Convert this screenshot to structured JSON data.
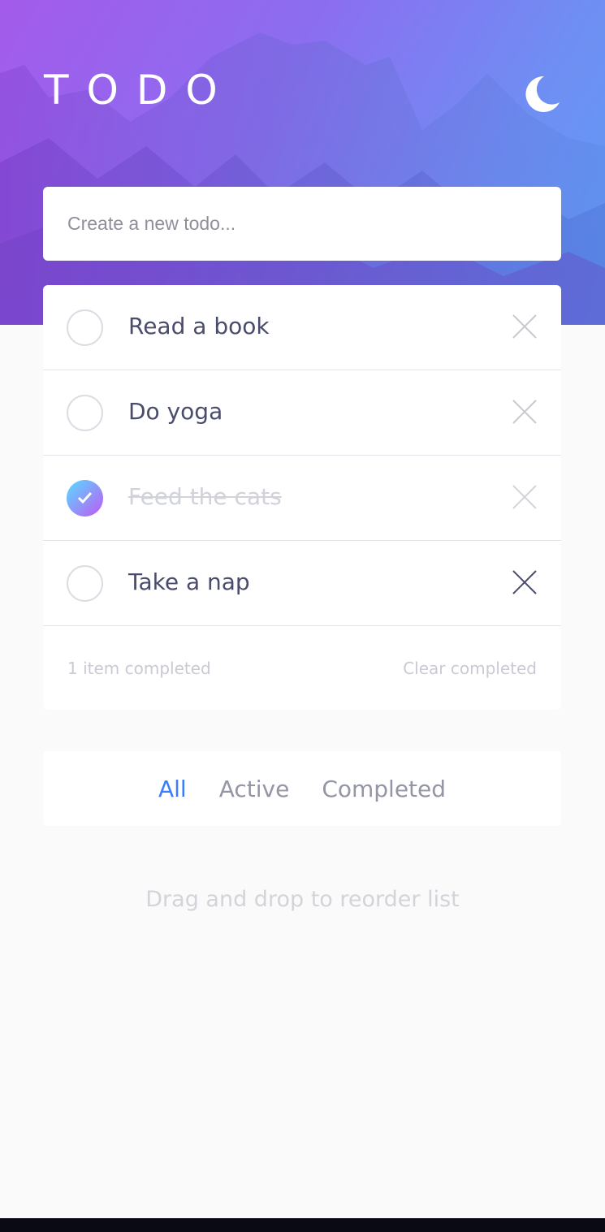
{
  "header": {
    "title": "TODO",
    "theme_icon": "moon-icon"
  },
  "new_todo": {
    "placeholder": "Create a new todo...",
    "value": ""
  },
  "todos": [
    {
      "label": "Read a book",
      "completed": false
    },
    {
      "label": "Do yoga",
      "completed": false
    },
    {
      "label": "Feed the cats",
      "completed": true
    },
    {
      "label": "Take a nap",
      "completed": false
    }
  ],
  "list_footer": {
    "count_text": "1 item completed",
    "clear_label": "Clear completed"
  },
  "filters": {
    "all": "All",
    "active": "Active",
    "completed": "Completed",
    "selected": "All"
  },
  "hint": "Drag and drop to reorder list",
  "colors": {
    "accent": "#3a7cfd",
    "check_gradient_start": "#57ddff",
    "check_gradient_end": "#c058f3",
    "text_primary": "#494c6b",
    "text_muted": "#c9cad3"
  }
}
